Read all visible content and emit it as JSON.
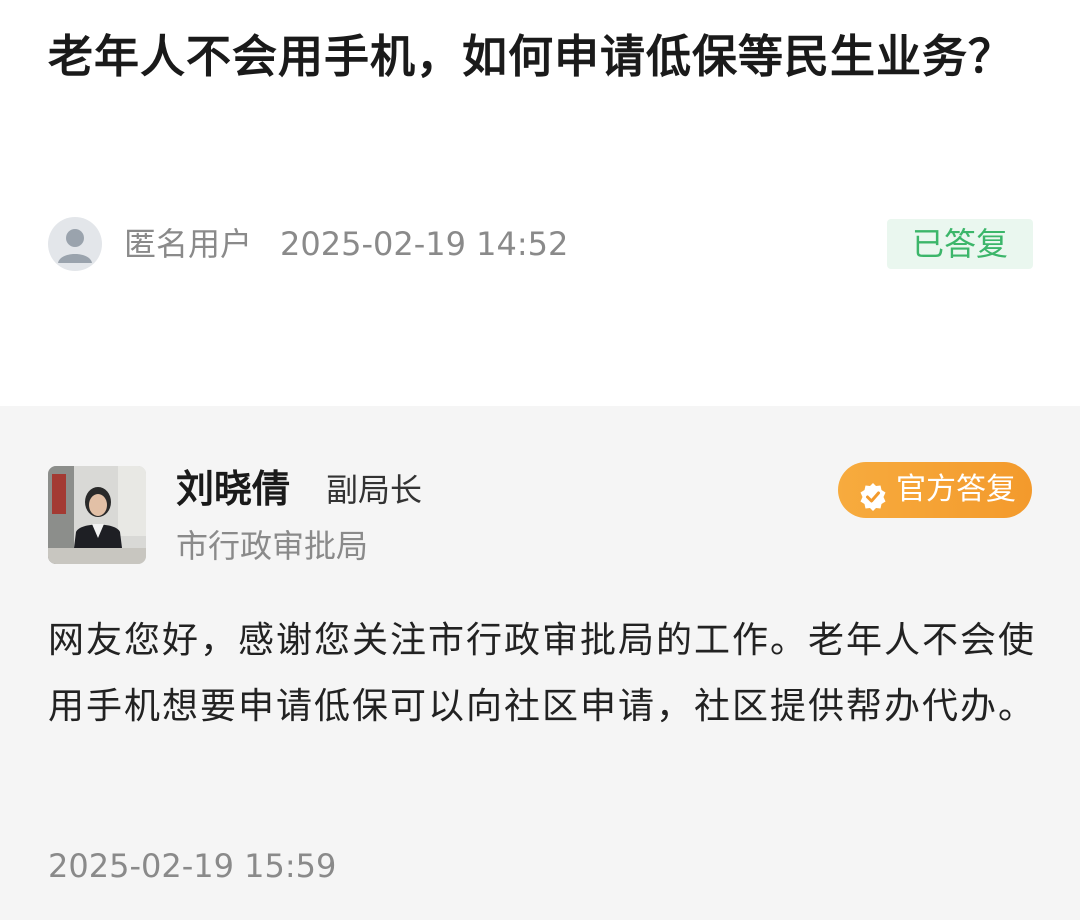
{
  "question": {
    "title": "老年人不会用手机，如何申请低保等民生业务？",
    "author": "匿名用户",
    "time": "2025-02-19 14:52",
    "status": "已答复",
    "status_color": "#3cb66a"
  },
  "answer": {
    "name": "刘晓倩",
    "title": "副局长",
    "department": "市行政审批局",
    "badge": "官方答复",
    "badge_color": "#f5a236",
    "body": "网友您好，感谢您关注市行政审批局的工作。老年人不会使用手机想要申请低保可以向社区申请，社区提供帮办代办。",
    "time": "2025-02-19 15:59"
  },
  "icons": {
    "anon_avatar": "user-silhouette-icon",
    "badge_icon": "check-shield-icon"
  }
}
